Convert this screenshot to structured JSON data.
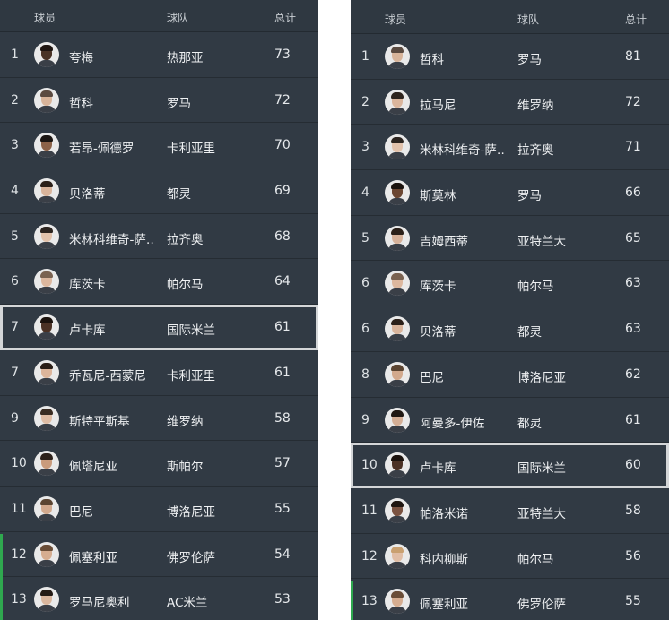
{
  "left": {
    "headers": {
      "player": "球员",
      "team": "球队",
      "total": "总计"
    },
    "rows": [
      {
        "rank": "1",
        "name": "夸梅",
        "team": "热那亚",
        "total": "73",
        "skin": "#4a3326",
        "hair": "#1e1410"
      },
      {
        "rank": "2",
        "name": "哲科",
        "team": "罗马",
        "total": "72",
        "skin": "#d8b49a",
        "hair": "#5a4a40"
      },
      {
        "rank": "3",
        "name": "若昂-佩德罗",
        "team": "卡利亚里",
        "total": "70",
        "skin": "#8c6248",
        "hair": "#1b1512"
      },
      {
        "rank": "4",
        "name": "贝洛蒂",
        "team": "都灵",
        "total": "69",
        "skin": "#d9b49b",
        "hair": "#2b2019"
      },
      {
        "rank": "5",
        "name": "米林科维奇-萨…",
        "team": "拉齐奥",
        "total": "68",
        "skin": "#e2c2ab",
        "hair": "#2c241f"
      },
      {
        "rank": "6",
        "name": "库茨卡",
        "team": "帕尔马",
        "total": "64",
        "skin": "#dcb79e",
        "hair": "#7a6250"
      },
      {
        "rank": "7",
        "name": "卢卡库",
        "team": "国际米兰",
        "total": "61",
        "skin": "#4b3124",
        "hair": "#1b120d"
      },
      {
        "rank": "7",
        "name": "乔瓦尼-西蒙尼",
        "team": "卡利亚里",
        "total": "61",
        "skin": "#dcb59b",
        "hair": "#2a1e17"
      },
      {
        "rank": "9",
        "name": "斯特平斯基",
        "team": "维罗纳",
        "total": "58",
        "skin": "#dfbca4",
        "hair": "#3a2c22"
      },
      {
        "rank": "10",
        "name": "佩塔尼亚",
        "team": "斯帕尔",
        "total": "57",
        "skin": "#c99b7c",
        "hair": "#2d211a"
      },
      {
        "rank": "11",
        "name": "巴尼",
        "team": "博洛尼亚",
        "total": "55",
        "skin": "#d2a98d",
        "hair": "#5b4431"
      },
      {
        "rank": "12",
        "name": "佩塞利亚",
        "team": "佛罗伦萨",
        "total": "54",
        "skin": "#d6ad90",
        "hair": "#6a4d37"
      },
      {
        "rank": "13",
        "name": "罗马尼奥利",
        "team": "AC米兰",
        "total": "53",
        "skin": "#dab69d",
        "hair": "#251b15"
      }
    ]
  },
  "right": {
    "headers": {
      "player": "球员",
      "team": "球队",
      "total": "总计"
    },
    "rows": [
      {
        "rank": "1",
        "name": "哲科",
        "team": "罗马",
        "total": "81",
        "skin": "#d8b49a",
        "hair": "#5a4a40"
      },
      {
        "rank": "2",
        "name": "拉马尼",
        "team": "维罗纳",
        "total": "72",
        "skin": "#dab59c",
        "hair": "#2e241d"
      },
      {
        "rank": "3",
        "name": "米林科维奇-萨…",
        "team": "拉齐奥",
        "total": "71",
        "skin": "#e2c2ab",
        "hair": "#2c241f"
      },
      {
        "rank": "4",
        "name": "斯莫林",
        "team": "罗马",
        "total": "66",
        "skin": "#6b4632",
        "hair": "#1b130e"
      },
      {
        "rank": "5",
        "name": "吉姆西蒂",
        "team": "亚特兰大",
        "total": "65",
        "skin": "#d6b199",
        "hair": "#2a1f18"
      },
      {
        "rank": "6",
        "name": "库茨卡",
        "team": "帕尔马",
        "total": "63",
        "skin": "#dcb79e",
        "hair": "#7a6250"
      },
      {
        "rank": "6",
        "name": "贝洛蒂",
        "team": "都灵",
        "total": "63",
        "skin": "#d9b49b",
        "hair": "#2b2019"
      },
      {
        "rank": "8",
        "name": "巴尼",
        "team": "博洛尼亚",
        "total": "62",
        "skin": "#d2a98d",
        "hair": "#5b4431"
      },
      {
        "rank": "9",
        "name": "阿曼多-伊佐",
        "team": "都灵",
        "total": "61",
        "skin": "#d4ae95",
        "hair": "#201813"
      },
      {
        "rank": "10",
        "name": "卢卡库",
        "team": "国际米兰",
        "total": "60",
        "skin": "#4b3124",
        "hair": "#1b120d"
      },
      {
        "rank": "11",
        "name": "帕洛米诺",
        "team": "亚特兰大",
        "total": "58",
        "skin": "#7a5240",
        "hair": "#1e1510"
      },
      {
        "rank": "12",
        "name": "科内柳斯",
        "team": "帕尔马",
        "total": "56",
        "skin": "#e0bda5",
        "hair": "#c9a070"
      },
      {
        "rank": "13",
        "name": "佩塞利亚",
        "team": "佛罗伦萨",
        "total": "55",
        "skin": "#d6ad90",
        "hair": "#6a4d37"
      }
    ]
  },
  "colors": {
    "panel_bg": "#313a44",
    "highlight_border": "#d4d6d8",
    "accent_green": "#2fa84f"
  }
}
